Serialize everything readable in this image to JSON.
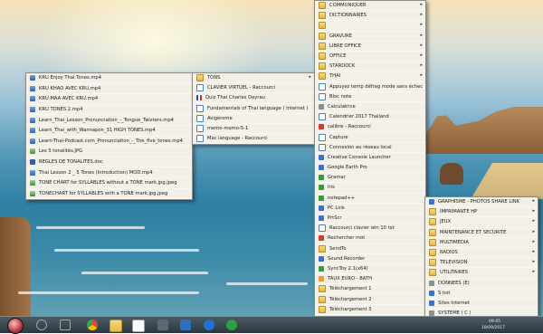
{
  "left_menu": {
    "items": [
      {
        "label": "KRU  Enjoy Thai Tones.mp4",
        "icon": "video-icon"
      },
      {
        "label": "KRU KHAO AVEC KRU.mp4",
        "icon": "video-icon"
      },
      {
        "label": "KRU MAA AVEC KRU.mp4",
        "icon": "video-icon"
      },
      {
        "label": "KRU TONES 2.mp4",
        "icon": "video-icon"
      },
      {
        "label": "Learn_Thai_Lesson_Pronunciation_-_Tongue_Twisters.mp4",
        "icon": "video-icon"
      },
      {
        "label": "Learn_Thai_with_Wannapon_31 HIGH TONES.mp4",
        "icon": "video-icon"
      },
      {
        "label": "Learn-Thai-Podcast.com_Pronunciation_-_The_five_tones.mp4",
        "icon": "video-icon"
      },
      {
        "label": "Les 5 tonalités.JPG",
        "icon": "image-icon"
      },
      {
        "label": "REGLES DE TONALITES.doc",
        "icon": "doc-icon"
      },
      {
        "label": "Thai Lesson 2 _ 5 Tones (Introduction) MOD.mp4",
        "icon": "video-icon"
      },
      {
        "label": "TONE CHART  for SYLLABLES  without a TONE mark.jpg.jpeg",
        "icon": "image-icon"
      },
      {
        "label": "TONECHART  for SYLLABLES with a TONE mark.jpg.jpeg",
        "icon": "image-icon"
      }
    ]
  },
  "mid_menu": {
    "items": [
      {
        "label": "TONS",
        "icon": "folder-icon",
        "arrow": true
      },
      {
        "label": "CLAVIER VIRTUEL - Raccourci",
        "icon": "file-icon",
        "arrow": false
      },
      {
        "label": "Quiz Thai Charles Deyrau",
        "icon": "flag-icon",
        "arrow": false
      },
      {
        "label": "Fundamentals of Thai language ( Internet )",
        "icon": "file-icon",
        "arrow": false
      },
      {
        "label": "Avigérome",
        "icon": "file-icon",
        "arrow": false
      },
      {
        "label": "memo-memo-5-1",
        "icon": "file-icon",
        "arrow": false
      },
      {
        "label": "Mac language - Raccourci",
        "icon": "file-icon",
        "arrow": false
      }
    ]
  },
  "main_menu": {
    "items": [
      {
        "label": "COMMUNIQUER",
        "icon": "folder-icon",
        "arrow": true
      },
      {
        "label": "DICTIONNAIRES",
        "icon": "folder-icon",
        "arrow": true
      },
      {
        "label": "",
        "icon": "folder-icon",
        "arrow": true
      },
      {
        "label": "GRAVURE",
        "icon": "folder-icon",
        "arrow": true
      },
      {
        "label": "LIBRE OFFICE",
        "icon": "folder-icon",
        "arrow": true
      },
      {
        "label": "OFFICE",
        "icon": "folder-icon",
        "arrow": true
      },
      {
        "label": "STARDOCK",
        "icon": "folder-icon",
        "arrow": true
      },
      {
        "label": "THAI",
        "icon": "folder-icon",
        "arrow": true
      },
      {
        "label": "Appuyez temp défrag mode sans échec",
        "icon": "file-icon",
        "arrow": false
      },
      {
        "label": "Bloc note",
        "icon": "file-icon",
        "arrow": false
      },
      {
        "label": "Calculatrice",
        "icon": "calc-icon",
        "arrow": false
      },
      {
        "label": "Calendrier 2017 Thailand",
        "icon": "file-icon",
        "arrow": false
      },
      {
        "label": "calibre - Raccourci",
        "icon": "red-icon",
        "arrow": false
      },
      {
        "label": "Capture",
        "icon": "file-icon",
        "arrow": false
      },
      {
        "label": "Connexion au réseau local",
        "icon": "file-icon",
        "arrow": false
      },
      {
        "label": "Creative Console Launcher",
        "icon": "blue-icon",
        "arrow": false
      },
      {
        "label": "Google Earth Pro",
        "icon": "blue-icon",
        "arrow": false
      },
      {
        "label": "Gramar",
        "icon": "green-icon",
        "arrow": false
      },
      {
        "label": "Iris",
        "icon": "green-icon",
        "arrow": false
      },
      {
        "label": "notepad++",
        "icon": "green-icon",
        "arrow": false
      },
      {
        "label": "PC Link",
        "icon": "blue-icon",
        "arrow": false
      },
      {
        "label": "PrtScr",
        "icon": "blue-icon",
        "arrow": false
      },
      {
        "label": "Raccourci clavier win 10 txt",
        "icon": "file-icon",
        "arrow": false
      },
      {
        "label": "Rechercher mot",
        "icon": "red-icon",
        "arrow": false
      },
      {
        "label": "SendTo",
        "icon": "folder-icon",
        "arrow": false
      },
      {
        "label": "Sound Recorder",
        "icon": "blue-icon",
        "arrow": false
      },
      {
        "label": "SyncToy 2.1(x64)",
        "icon": "green-icon",
        "arrow": false
      },
      {
        "label": "TAUX EURO - BATH",
        "icon": "orange-icon",
        "arrow": false
      },
      {
        "label": "Téléchargement 1",
        "icon": "folder-icon",
        "arrow": false
      },
      {
        "label": "Téléchargement 2",
        "icon": "folder-icon",
        "arrow": false
      },
      {
        "label": "Téléchargement 3",
        "icon": "folder-icon",
        "arrow": false
      },
      {
        "label": "Téléchargements",
        "icon": "folder-icon",
        "arrow": false
      }
    ]
  },
  "right_menu": {
    "items": [
      {
        "label": "GRAPHISME - PHOTOS SHARE LINK",
        "icon": "blue-icon",
        "arrow": true
      },
      {
        "label": "IMPRIMANTE HP",
        "icon": "folder-icon",
        "arrow": true
      },
      {
        "label": "JEUX",
        "icon": "folder-icon",
        "arrow": true
      },
      {
        "label": "MAINTENANCE ET SECURITE",
        "icon": "folder-icon",
        "arrow": true
      },
      {
        "label": "MULTIMEDIA",
        "icon": "folder-icon",
        "arrow": true
      },
      {
        "label": "RADIOS",
        "icon": "folder-icon",
        "arrow": true
      },
      {
        "label": "TELEVISION",
        "icon": "folder-icon",
        "arrow": true
      },
      {
        "label": "UTILITAIRES",
        "icon": "folder-icon",
        "arrow": true
      },
      {
        "label": "DONNEES  (E)",
        "icon": "grey-icon",
        "arrow": false
      },
      {
        "label": "S hot",
        "icon": "blue-icon",
        "arrow": false
      },
      {
        "label": "Sites Internet",
        "icon": "blue-icon",
        "arrow": false
      },
      {
        "label": "SYSTEME  ( C )",
        "icon": "grey-icon",
        "arrow": false
      }
    ]
  },
  "taskbar": {
    "clock_time": "09:45",
    "clock_date": "18/09/2017"
  }
}
